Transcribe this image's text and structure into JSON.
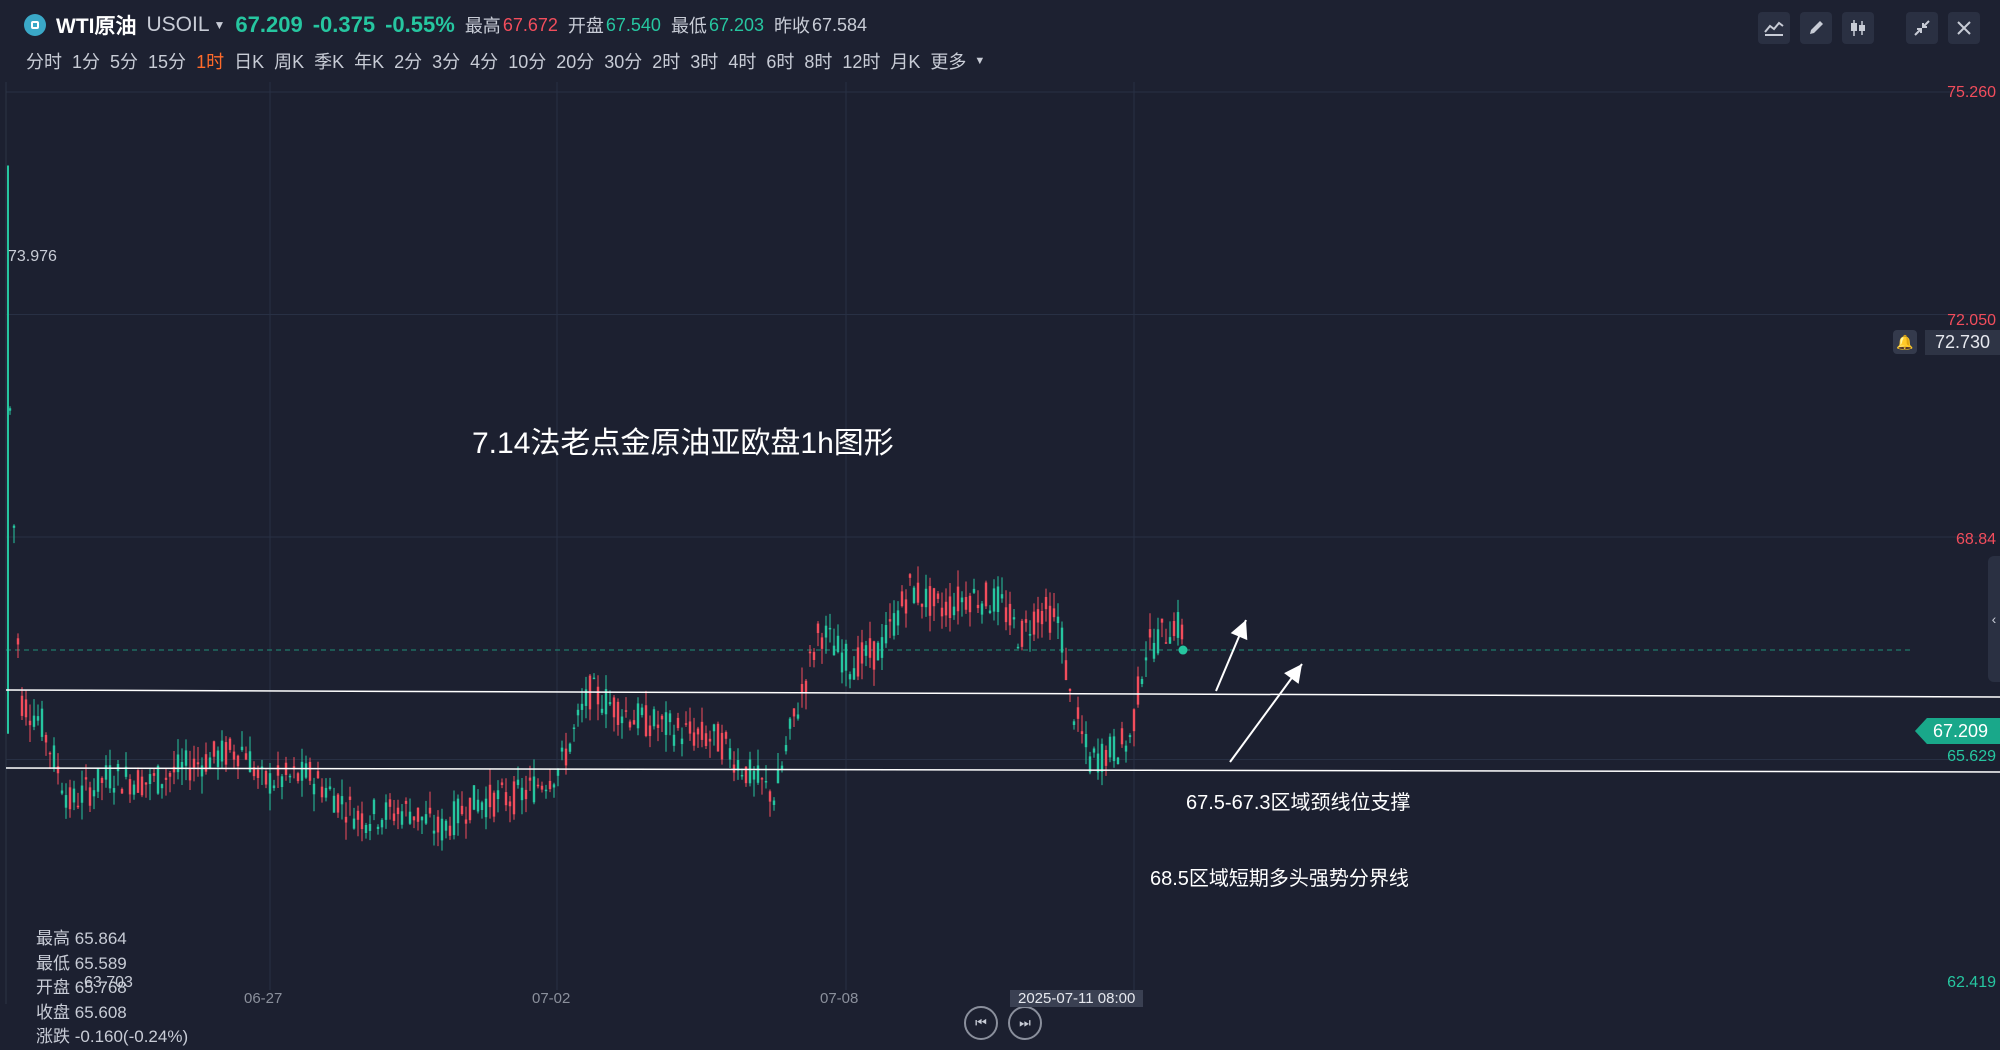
{
  "header": {
    "symbol_name": "WTI原油",
    "symbol_code": "USOIL",
    "price": "67.209",
    "change": "-0.375",
    "change_pct": "-0.55%",
    "high_label": "最高",
    "high": "67.672",
    "open_label": "开盘",
    "open": "67.540",
    "low_label": "最低",
    "low": "67.203",
    "prev_label": "昨收",
    "prev_close": "67.584"
  },
  "timeframes": [
    "分时",
    "1分",
    "5分",
    "15分",
    "1时",
    "日K",
    "周K",
    "季K",
    "年K",
    "2分",
    "3分",
    "4分",
    "10分",
    "20分",
    "30分",
    "2时",
    "3时",
    "4时",
    "6时",
    "8时",
    "12时",
    "月K",
    "更多"
  ],
  "active_timeframe": "1时",
  "toolbar_icons": [
    "indicator-icon",
    "draw-icon",
    "candle-type-icon",
    "collapse-icon",
    "close-icon"
  ],
  "price_axis": {
    "labels": [
      {
        "value": "75.260",
        "color": "red"
      },
      {
        "value": "72.050",
        "color": "red"
      },
      {
        "value": "68.84",
        "color": "red"
      },
      {
        "value": "65.629",
        "color": "green"
      },
      {
        "value": "62.419",
        "color": "green"
      }
    ],
    "current": "67.209",
    "alert": "72.730"
  },
  "chart_max_label": "73.976",
  "chart_min_label": "63.703",
  "annotations": {
    "title": "7.14法老点金原油亚欧盘1h图形",
    "line1": "67.5-67.3区域颈线位支撑",
    "line2": "68.5区域短期多头强势分界线"
  },
  "ohlc": {
    "high_label": "最高",
    "high": "65.864",
    "low_label": "最低",
    "low": "65.589",
    "open_label": "开盘",
    "open": "65.768",
    "close_label": "收盘",
    "close": "65.608",
    "chg_label": "涨跌",
    "chg": "-0.160(-0.24%)"
  },
  "dates": [
    "06-27",
    "07-02",
    "07-08"
  ],
  "cursor_date": "2025-07-11 08:00",
  "colors": {
    "up": "#26c6a0",
    "down": "#f24d5c",
    "bg": "#1c2030",
    "accent": "#ff6a2a"
  }
}
